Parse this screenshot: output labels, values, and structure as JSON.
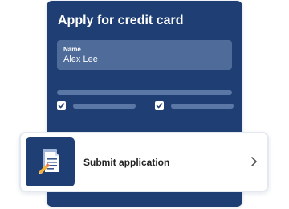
{
  "card": {
    "title": "Apply for credit card",
    "name_field": {
      "label": "Name",
      "value": "Alex Lee"
    },
    "checkboxes": [
      {
        "checked": true
      },
      {
        "checked": true
      }
    ]
  },
  "submit": {
    "label": "Submit application",
    "icon": "document-pen-icon",
    "chevron_icon": "chevron-right-icon"
  },
  "colors": {
    "card_bg": "#1f3f74",
    "field_bg": "#4e6b9a",
    "skeleton": "#5b77a5",
    "text_dark": "#222222"
  }
}
